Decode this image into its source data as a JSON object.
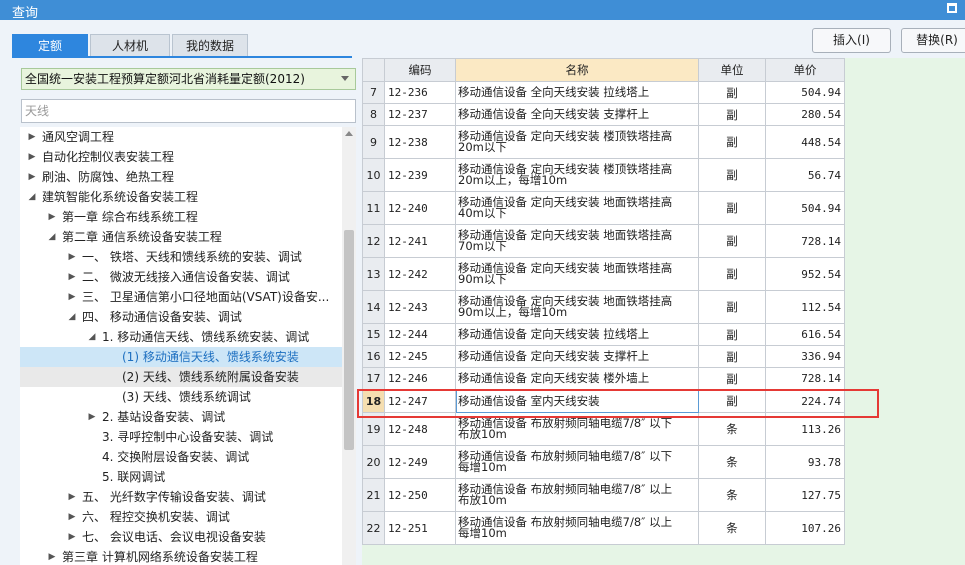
{
  "window": {
    "title": "查询"
  },
  "tabs": [
    "定额",
    "人材机",
    "我的数据"
  ],
  "actions": {
    "insert": "插入(I)",
    "replace": "替换(R)"
  },
  "library": {
    "selected": "全国统一安装工程预算定额河北省消耗量定额(2012)"
  },
  "search": {
    "value": "",
    "placeholder": "天线"
  },
  "tree": [
    {
      "label": "通风空调工程",
      "level": 0,
      "state": "collapsed"
    },
    {
      "label": "自动化控制仪表安装工程",
      "level": 0,
      "state": "collapsed"
    },
    {
      "label": "刷油、防腐蚀、绝热工程",
      "level": 0,
      "state": "collapsed"
    },
    {
      "label": "建筑智能化系统设备安装工程",
      "level": 0,
      "state": "expanded"
    },
    {
      "label": "第一章 综合布线系统工程",
      "level": 1,
      "state": "collapsed"
    },
    {
      "label": "第二章 通信系统设备安装工程",
      "level": 1,
      "state": "expanded"
    },
    {
      "label": "一、 铁塔、天线和馈线系统的安装、调试",
      "level": 2,
      "state": "collapsed"
    },
    {
      "label": "二、 微波无线接入通信设备安装、调试",
      "level": 2,
      "state": "collapsed"
    },
    {
      "label": "三、 卫星通信第小口径地面站(VSAT)设备安...",
      "level": 2,
      "state": "collapsed"
    },
    {
      "label": "四、 移动通信设备安装、调试",
      "level": 2,
      "state": "expanded"
    },
    {
      "label": "1. 移动通信天线、馈线系统安装、调试",
      "level": 3,
      "state": "expanded"
    },
    {
      "label": "(1) 移动通信天线、馈线系统安装",
      "level": 4,
      "state": "leaf",
      "selected": true
    },
    {
      "label": "(2) 天线、馈线系统附属设备安装",
      "level": 4,
      "state": "leaf",
      "hover": true
    },
    {
      "label": "(3) 天线、馈线系统调试",
      "level": 4,
      "state": "leaf"
    },
    {
      "label": "2. 基站设备安装、调试",
      "level": 3,
      "state": "collapsed"
    },
    {
      "label": "3. 寻呼控制中心设备安装、调试",
      "level": 3,
      "state": "leaf"
    },
    {
      "label": "4. 交换附层设备安装、调试",
      "level": 3,
      "state": "leaf"
    },
    {
      "label": "5. 联网调试",
      "level": 3,
      "state": "leaf"
    },
    {
      "label": "五、 光纤数字传输设备安装、调试",
      "level": 2,
      "state": "collapsed"
    },
    {
      "label": "六、 程控交换机安装、调试",
      "level": 2,
      "state": "collapsed"
    },
    {
      "label": "七、 会议电话、会议电视设备安装",
      "level": 2,
      "state": "collapsed"
    },
    {
      "label": "第三章 计算机网络系统设备安装工程",
      "level": 1,
      "state": "collapsed"
    }
  ],
  "grid": {
    "columns": [
      "",
      "编码",
      "名称",
      "单位",
      "单价"
    ],
    "current_row": "18",
    "rows": [
      {
        "rn": "7",
        "code": "12-236",
        "name": [
          "移动通信设备 全向天线安装 拉线塔上"
        ],
        "unit": "副",
        "price": "504.94"
      },
      {
        "rn": "8",
        "code": "12-237",
        "name": [
          "移动通信设备 全向天线安装 支撑杆上"
        ],
        "unit": "副",
        "price": "280.54"
      },
      {
        "rn": "9",
        "code": "12-238",
        "name": [
          "移动通信设备 定向天线安装 楼顶铁塔挂高",
          "20m以下"
        ],
        "unit": "副",
        "price": "448.54"
      },
      {
        "rn": "10",
        "code": "12-239",
        "name": [
          "移动通信设备 定向天线安装 楼顶铁塔挂高",
          "20m以上，每增10m"
        ],
        "unit": "副",
        "price": "56.74"
      },
      {
        "rn": "11",
        "code": "12-240",
        "name": [
          "移动通信设备 定向天线安装 地面铁塔挂高",
          "40m以下"
        ],
        "unit": "副",
        "price": "504.94"
      },
      {
        "rn": "12",
        "code": "12-241",
        "name": [
          "移动通信设备 定向天线安装 地面铁塔挂高",
          "70m以下"
        ],
        "unit": "副",
        "price": "728.14"
      },
      {
        "rn": "13",
        "code": "12-242",
        "name": [
          "移动通信设备 定向天线安装 地面铁塔挂高",
          "90m以下"
        ],
        "unit": "副",
        "price": "952.54"
      },
      {
        "rn": "14",
        "code": "12-243",
        "name": [
          "移动通信设备 定向天线安装 地面铁塔挂高",
          "90m以上，每增10m"
        ],
        "unit": "副",
        "price": "112.54"
      },
      {
        "rn": "15",
        "code": "12-244",
        "name": [
          "移动通信设备 定向天线安装 拉线塔上"
        ],
        "unit": "副",
        "price": "616.54"
      },
      {
        "rn": "16",
        "code": "12-245",
        "name": [
          "移动通信设备 定向天线安装 支撑杆上"
        ],
        "unit": "副",
        "price": "336.94"
      },
      {
        "rn": "17",
        "code": "12-246",
        "name": [
          "移动通信设备 定向天线安装 楼外墙上"
        ],
        "unit": "副",
        "price": "728.14"
      },
      {
        "rn": "18",
        "code": "12-247",
        "name": [
          "移动通信设备 室内天线安装"
        ],
        "unit": "副",
        "price": "224.74"
      },
      {
        "rn": "19",
        "code": "12-248",
        "name": [
          "移动通信设备 布放射频同轴电缆7/8″ 以下",
          "布放10m"
        ],
        "unit": "条",
        "price": "113.26"
      },
      {
        "rn": "20",
        "code": "12-249",
        "name": [
          "移动通信设备 布放射频同轴电缆7/8″ 以下",
          "每增10m"
        ],
        "unit": "条",
        "price": "93.78"
      },
      {
        "rn": "21",
        "code": "12-250",
        "name": [
          "移动通信设备 布放射频同轴电缆7/8″ 以上",
          "布放10m"
        ],
        "unit": "条",
        "price": "127.75"
      },
      {
        "rn": "22",
        "code": "12-251",
        "name": [
          "移动通信设备 布放射频同轴电缆7/8″ 以上",
          "每增10m"
        ],
        "unit": "条",
        "price": "107.26"
      }
    ]
  }
}
